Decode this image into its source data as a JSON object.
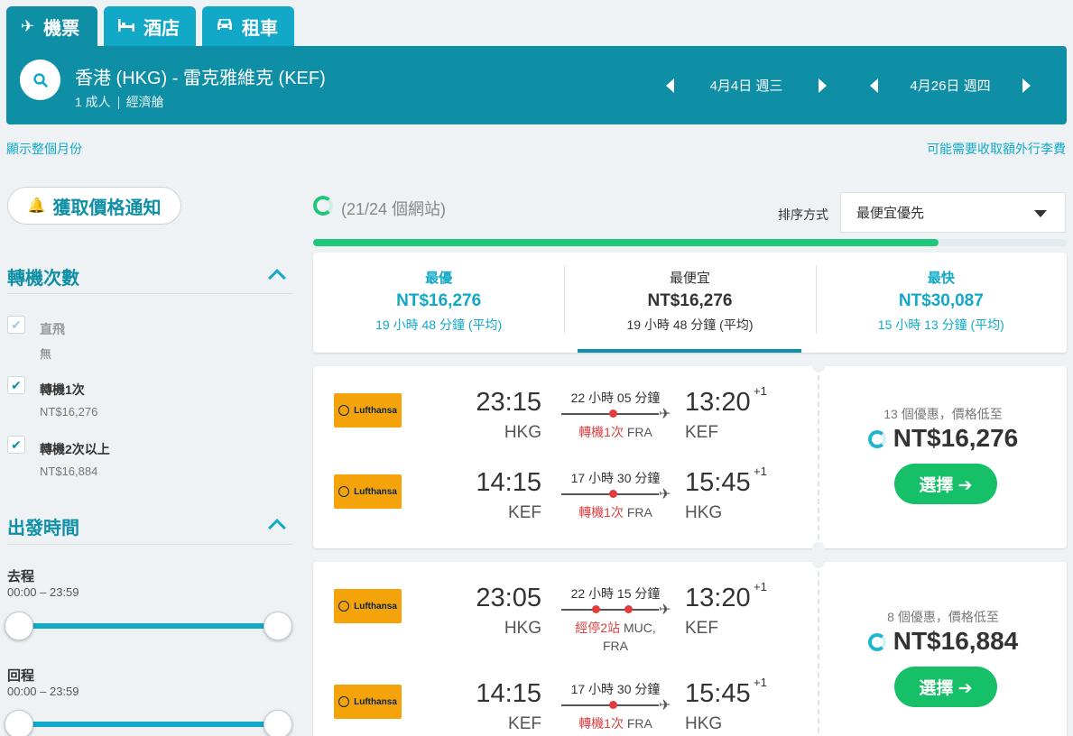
{
  "tabs": [
    {
      "label": "機票",
      "icon": "plane-icon"
    },
    {
      "label": "酒店",
      "icon": "bed-icon"
    },
    {
      "label": "租車",
      "icon": "car-icon"
    }
  ],
  "search": {
    "route": "香港 (HKG) - 雷克雅維克 (KEF)",
    "travelers": "1 成人",
    "cabin": "經濟艙",
    "depart_date": "4月4日 週三",
    "return_date": "4月26日 週四"
  },
  "links": {
    "show_month": "顯示整個月份",
    "baggage_fees": "可能需要收取額外行李費"
  },
  "sidebar": {
    "price_alert": "獲取價格通知",
    "stops": {
      "title": "轉機次數",
      "options": [
        {
          "label": "直飛",
          "sub": "無"
        },
        {
          "label": "轉機1次",
          "sub": "NT$16,276"
        },
        {
          "label": "轉機2次以上",
          "sub": "NT$16,884"
        }
      ]
    },
    "times": {
      "title": "出發時間",
      "outbound_label": "去程",
      "outbound_range": "00:00 – 23:59",
      "return_label": "回程",
      "return_range": "00:00 – 23:59"
    }
  },
  "main": {
    "progress_text": "(21/24 個網站)",
    "progress_fraction": 0.83,
    "sort_label": "排序方式",
    "sort_value": "最便宜優先",
    "summary": [
      {
        "title": "最優",
        "price": "NT$16,276",
        "duration": "19 小時 48 分鐘 (平均)"
      },
      {
        "title": "最便宜",
        "price": "NT$16,276",
        "duration": "19 小時 48 分鐘 (平均)"
      },
      {
        "title": "最快",
        "price": "NT$30,087",
        "duration": "15 小時 13 分鐘 (平均)"
      }
    ],
    "results": [
      {
        "airline": "Lufthansa",
        "deals": "13 個優惠，價格低至",
        "price": "NT$16,276",
        "select": "選擇 ➔",
        "legs": [
          {
            "dep_time": "23:15",
            "dep_code": "HKG",
            "arr_time": "13:20",
            "arr_plus": "+1",
            "arr_code": "KEF",
            "duration": "22 小時 05 分鐘",
            "stops_red": "轉機1次",
            "stops_via": "FRA"
          },
          {
            "dep_time": "14:15",
            "dep_code": "KEF",
            "arr_time": "15:45",
            "arr_plus": "+1",
            "arr_code": "HKG",
            "duration": "17 小時 30 分鐘",
            "stops_red": "轉機1次",
            "stops_via": "FRA"
          }
        ]
      },
      {
        "airline": "Lufthansa",
        "deals": "8 個優惠，價格低至",
        "price": "NT$16,884",
        "select": "選擇 ➔",
        "legs": [
          {
            "dep_time": "23:05",
            "dep_code": "HKG",
            "arr_time": "13:20",
            "arr_plus": "+1",
            "arr_code": "KEF",
            "duration": "22 小時 15 分鐘",
            "stops_red": "經停2站",
            "stops_via": "MUC,",
            "stops_via2": "FRA"
          },
          {
            "dep_time": "14:15",
            "dep_code": "KEF",
            "arr_time": "15:45",
            "arr_plus": "+1",
            "arr_code": "HKG",
            "duration": "17 小時 30 分鐘",
            "stops_red": "轉機1次",
            "stops_via": "FRA"
          }
        ]
      }
    ]
  }
}
